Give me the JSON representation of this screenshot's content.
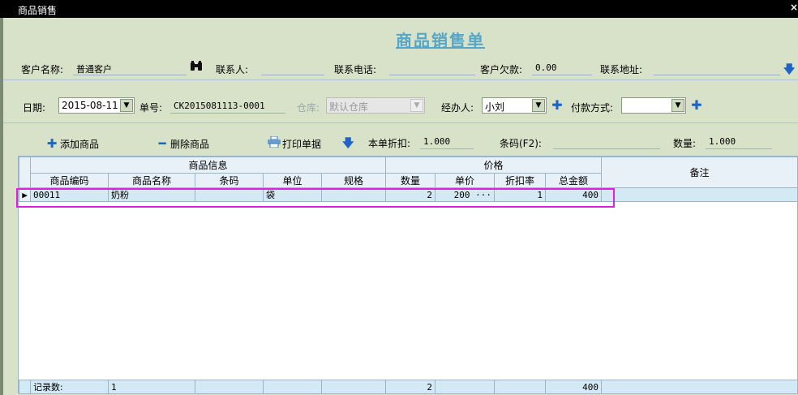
{
  "window": {
    "title": "商品销售",
    "close_icon": "×"
  },
  "form_title": "商品销售单",
  "row1": {
    "customer_label": "客户名称:",
    "customer_value": "普通客户",
    "contact_label": "联系人:",
    "contact_value": "",
    "phone_label": "联系电话:",
    "phone_value": "",
    "debt_label": "客户欠款:",
    "debt_value": "0.00",
    "address_label": "联系地址:",
    "address_value": ""
  },
  "row2": {
    "date_label": "日期:",
    "date_value": "2015-08-11",
    "order_label": "单号:",
    "order_value": "CK2015081113-0001",
    "warehouse_label": "仓库:",
    "warehouse_value": "默认仓库",
    "handler_label": "经办人:",
    "handler_value": "小刘",
    "payment_label": "付款方式:",
    "payment_value": ""
  },
  "toolbar": {
    "add_label": "添加商品",
    "delete_label": "删除商品",
    "print_label": "打印单据",
    "discount_label": "本单折扣:",
    "discount_value": "1.000",
    "barcode_label": "条码(F2):",
    "barcode_value": "",
    "qty_label": "数量:",
    "qty_value": "1.000"
  },
  "grid": {
    "group_product": "商品信息",
    "group_price": "价格",
    "remark_header": "备注",
    "columns": {
      "code": "商品编码",
      "name": "商品名称",
      "barcode": "条码",
      "unit": "单位",
      "spec": "规格",
      "qty": "数量",
      "price": "单价",
      "discount": "折扣率",
      "total": "总金额"
    },
    "rows": [
      {
        "code": "00011",
        "name": "奶粉",
        "barcode": "",
        "unit": "袋",
        "spec": "",
        "qty": "2",
        "price": "200",
        "price_ellipsis": "···",
        "discount": "1",
        "total": "400",
        "remark": ""
      }
    ],
    "footer": {
      "label": "记录数:",
      "count": "1",
      "qty": "2",
      "total": "400"
    }
  },
  "colors": {
    "background": "#d8e2c9",
    "title": "#55a6c8",
    "highlight": "#e020e0",
    "icon": "#1e64c8"
  }
}
